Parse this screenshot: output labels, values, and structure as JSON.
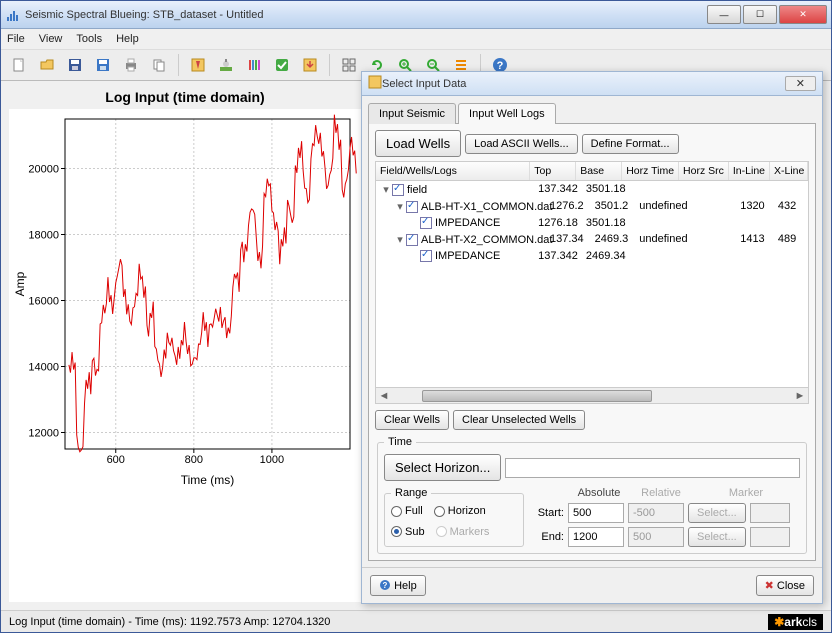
{
  "window": {
    "title": "Seismic Spectral Blueing: STB_dataset - Untitled"
  },
  "menu": {
    "file": "File",
    "view": "View",
    "tools": "Tools",
    "help": "Help"
  },
  "chart": {
    "title": "Log Input (time domain)",
    "xlabel": "Time (ms)",
    "ylabel": "Amp"
  },
  "chart_data": {
    "type": "line",
    "xlabel": "Time (ms)",
    "ylabel": "Amp",
    "title": "Log Input (time domain)",
    "xlim": [
      470,
      1200
    ],
    "ylim": [
      11500,
      21500
    ],
    "xticks": [
      600,
      800,
      1000
    ],
    "yticks": [
      12000,
      14000,
      16000,
      18000,
      20000
    ],
    "x": [
      480,
      500,
      520,
      540,
      560,
      580,
      600,
      620,
      640,
      660,
      680,
      700,
      720,
      740,
      760,
      780,
      800,
      820,
      840,
      860,
      880,
      900,
      920,
      940,
      960,
      980,
      1000,
      1020,
      1040,
      1060,
      1080,
      1100,
      1120,
      1140,
      1160,
      1180,
      1200
    ],
    "y": [
      13800,
      11800,
      13200,
      14200,
      15400,
      16200,
      16800,
      16000,
      15800,
      16600,
      15400,
      14200,
      14600,
      14400,
      14800,
      14200,
      14600,
      15000,
      15600,
      15200,
      15400,
      16400,
      17800,
      18400,
      17600,
      19200,
      18600,
      17600,
      18800,
      20200,
      19400,
      20800,
      20600,
      19800,
      21000,
      19600,
      20400
    ]
  },
  "dialog": {
    "title": "Select Input Data",
    "tabs": {
      "seismic": "Input Seismic",
      "wells": "Input Well Logs"
    },
    "buttons": {
      "load_wells": "Load Wells",
      "load_ascii": "Load ASCII Wells...",
      "define_format": "Define Format...",
      "clear_wells": "Clear Wells",
      "clear_unsel": "Clear Unselected Wells",
      "select_horizon": "Select Horizon...",
      "help": "Help",
      "close": "Close"
    },
    "table": {
      "headers": {
        "fwl": "Field/Wells/Logs",
        "top": "Top",
        "base": "Base",
        "horz_time": "Horz Time",
        "horz_src": "Horz Src",
        "inline": "In-Line",
        "xline": "X-Line"
      },
      "rows": [
        {
          "indent": 0,
          "expand": "▾",
          "label": "field",
          "top": "137.342",
          "base": "3501.18",
          "ht": "",
          "hs": "",
          "il": "",
          "xl": ""
        },
        {
          "indent": 1,
          "expand": "▾",
          "label": "ALB-HT-X1_COMMON.dat",
          "top": "1276.2",
          "base": "3501.2",
          "ht": "undefined",
          "hs": "",
          "il": "1320",
          "xl": "432"
        },
        {
          "indent": 2,
          "expand": "",
          "label": "IMPEDANCE",
          "top": "1276.18",
          "base": "3501.18",
          "ht": "",
          "hs": "",
          "il": "",
          "xl": ""
        },
        {
          "indent": 1,
          "expand": "▾",
          "label": "ALB-HT-X2_COMMON.dat",
          "top": "137.34",
          "base": "2469.3",
          "ht": "undefined",
          "hs": "",
          "il": "1413",
          "xl": "489"
        },
        {
          "indent": 2,
          "expand": "",
          "label": "IMPEDANCE",
          "top": "137.342",
          "base": "2469.34",
          "ht": "",
          "hs": "",
          "il": "",
          "xl": ""
        }
      ]
    },
    "time_label": "Time",
    "range": {
      "legend": "Range",
      "full": "Full",
      "horizon": "Horizon",
      "sub": "Sub",
      "markers": "Markers",
      "absolute": "Absolute",
      "relative": "Relative",
      "marker": "Marker",
      "start_lbl": "Start:",
      "end_lbl": "End:",
      "start_abs": "500",
      "start_rel": "-500",
      "start_sel": "Select...",
      "end_abs": "1200",
      "end_rel": "500",
      "end_sel": "Select..."
    }
  },
  "status": {
    "text": "Log Input (time domain)  -  Time (ms): 1192.7573  Amp: 12704.1320",
    "brand_a": "ark",
    "brand_b": "cls"
  },
  "close_x": "✕"
}
